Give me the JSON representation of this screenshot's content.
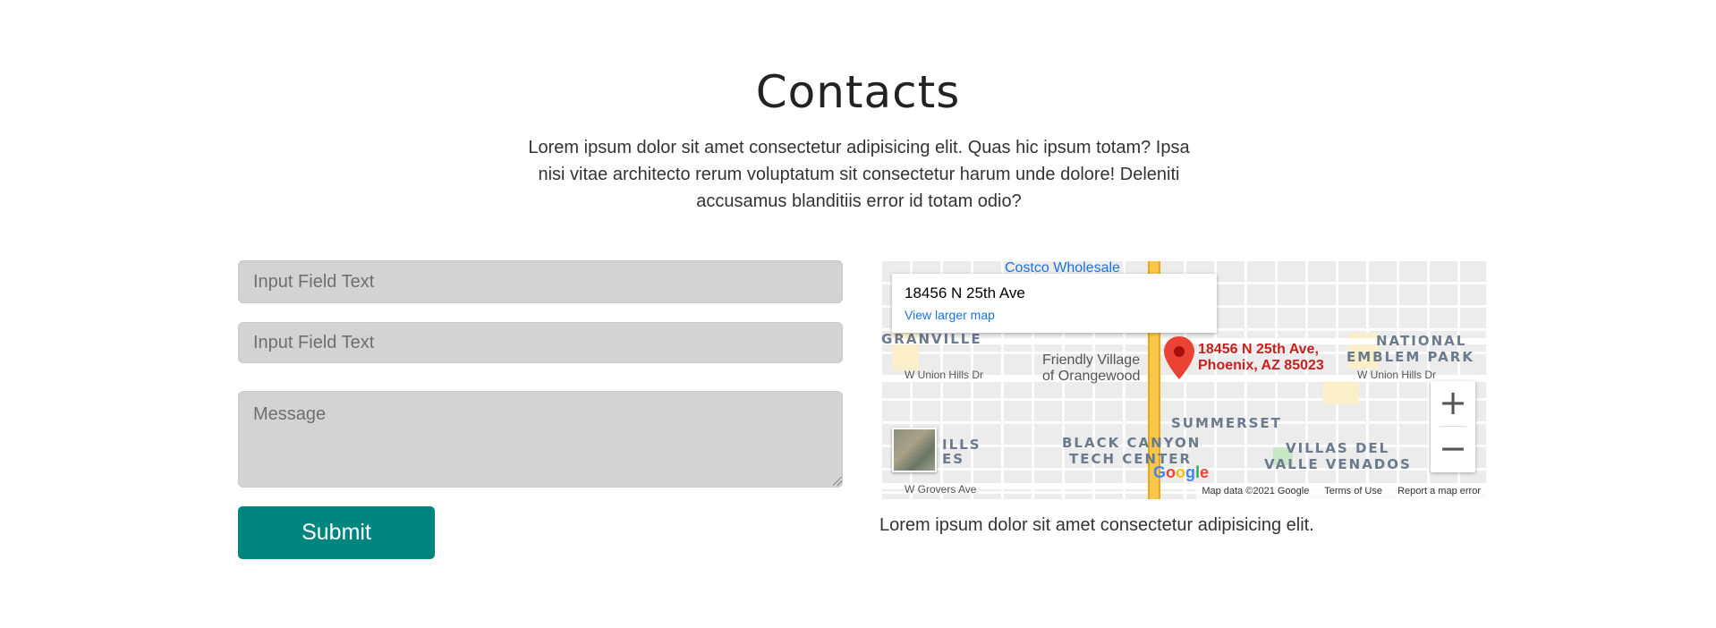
{
  "section": {
    "title": "Contacts",
    "intro": "Lorem ipsum dolor sit amet consectetur adipisicing elit. Quas hic ipsum totam? Ipsa nisi vitae architecto rerum voluptatum sit consectetur harum unde dolore! Deleniti accusamus blanditiis error id totam odio?"
  },
  "form": {
    "field1_placeholder": "Input Field Text",
    "field2_placeholder": "Input Field Text",
    "message_placeholder": "Message",
    "submit_label": "Submit",
    "submit_color": "#00857f"
  },
  "map": {
    "info_title": "18456 N 25th Ave",
    "info_link": "View larger map",
    "pin_label_line1": "18456 N 25th Ave,",
    "pin_label_line2": "Phoenix, AZ 85023",
    "poi_costco": "Costco Wholesale",
    "area_granville": "GRANVILLE",
    "area_national1": "NATIONAL",
    "area_national2": "EMBLEM PARK",
    "area_summerset": "SUMMERSET",
    "area_blackcanyon1": "BLACK CANYON",
    "area_blackcanyon2": "TECH CENTER",
    "area_villas1": "VILLAS DEL",
    "area_villas2": "VALLE VENADOS",
    "area_hills1": "ILLS",
    "area_hills2": "ES",
    "place_friendly1": "Friendly Village",
    "place_friendly2": "of Orangewood",
    "street_union_w": "W Union Hills Dr",
    "street_union_e": "W Union Hills Dr",
    "street_grovers": "W Grovers Ave",
    "zoom_in": "+",
    "zoom_out": "−",
    "google_g": "G",
    "google_o1": "o",
    "google_o2": "o",
    "google_g2": "g",
    "google_l": "l",
    "google_e": "e",
    "attrib_data": "Map data ©2021 Google",
    "attrib_terms": "Terms of Use",
    "attrib_report": "Report a map error"
  },
  "caption": "Lorem ipsum dolor sit amet consectetur adipisicing elit."
}
